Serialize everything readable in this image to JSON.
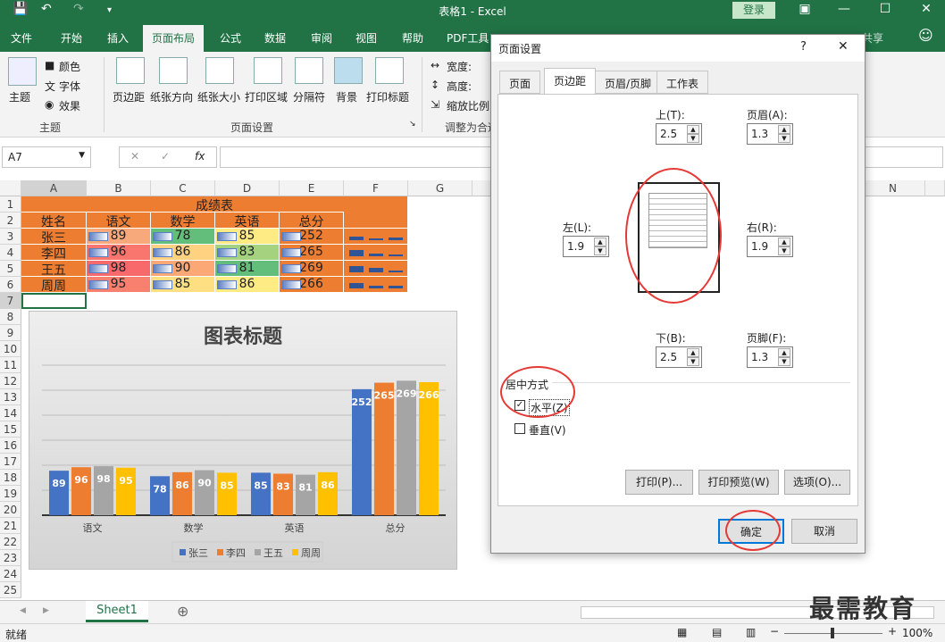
{
  "window": {
    "title": "表格1 - Excel",
    "login": "登录"
  },
  "tabs": [
    "文件",
    "开始",
    "插入",
    "页面布局",
    "公式",
    "数据",
    "审阅",
    "视图",
    "帮助",
    "PDF工具"
  ],
  "ribbon": {
    "theme_group": {
      "theme": "主题",
      "colors": "颜色",
      "fonts": "字体",
      "effects": "效果",
      "label": "主题"
    },
    "page_setup_group": {
      "margins": "页边距",
      "orientation": "纸张方向",
      "size": "纸张大小",
      "print_area": "打印区域",
      "breaks": "分隔符",
      "background": "背景",
      "print_titles": "打印标题",
      "label": "页面设置"
    },
    "scale_group": {
      "width": "宽度:",
      "height": "高度:",
      "scale": "缩放比例",
      "label": "调整为合适"
    },
    "share": "共享"
  },
  "formula_bar": {
    "name_box": "A7",
    "fx": "fx"
  },
  "columns": [
    "A",
    "B",
    "C",
    "D",
    "E",
    "F",
    "G",
    "N"
  ],
  "rows": [
    "1",
    "2",
    "3",
    "4",
    "5",
    "6",
    "7",
    "8",
    "9",
    "10",
    "11",
    "12",
    "13",
    "14",
    "15",
    "16",
    "17",
    "18",
    "19",
    "20",
    "21",
    "22",
    "23",
    "24",
    "25"
  ],
  "table": {
    "title": "成绩表",
    "headers": [
      "姓名",
      "语文",
      "数学",
      "英语",
      "总分"
    ],
    "rows": [
      {
        "name": "张三",
        "chinese": "89",
        "math": "78",
        "english": "85",
        "total": "252"
      },
      {
        "name": "李四",
        "chinese": "96",
        "math": "86",
        "english": "83",
        "total": "265"
      },
      {
        "name": "王五",
        "chinese": "98",
        "math": "90",
        "english": "81",
        "total": "269"
      },
      {
        "name": "周周",
        "chinese": "95",
        "math": "85",
        "english": "86",
        "total": "266"
      }
    ]
  },
  "chart_data": {
    "type": "bar",
    "title": "图表标题",
    "categories": [
      "语文",
      "数学",
      "英语",
      "总分"
    ],
    "series": [
      {
        "name": "张三",
        "values": [
          89,
          78,
          85,
          252
        ],
        "color": "#4472c4"
      },
      {
        "name": "李四",
        "values": [
          96,
          86,
          83,
          265
        ],
        "color": "#ed7d31"
      },
      {
        "name": "王五",
        "values": [
          98,
          90,
          81,
          269
        ],
        "color": "#a5a5a5"
      },
      {
        "name": "周周",
        "values": [
          95,
          85,
          86,
          266
        ],
        "color": "#ffc000"
      }
    ],
    "legend": "bottom"
  },
  "sheet_tabs": [
    "Sheet1"
  ],
  "status": {
    "left": "就绪",
    "zoom": "100%",
    "watermark": "最需教育"
  },
  "dialog": {
    "title": "页面设置",
    "help": "?",
    "close": "✕",
    "tabs": [
      "页面",
      "页边距",
      "页眉/页脚",
      "工作表"
    ],
    "top_label": "上(T):",
    "top_value": "2.5",
    "header_label": "页眉(A):",
    "header_value": "1.3",
    "left_label": "左(L):",
    "left_value": "1.9",
    "right_label": "右(R):",
    "right_value": "1.9",
    "bottom_label": "下(B):",
    "bottom_value": "2.5",
    "footer_label": "页脚(F):",
    "footer_value": "1.3",
    "center_section": "居中方式",
    "horizontal": "水平(Z)",
    "vertical": "垂直(V)",
    "print_button": "打印(P)...",
    "preview_button": "打印预览(W)",
    "options_button": "选项(O)...",
    "ok_button": "确定",
    "cancel_button": "取消"
  }
}
